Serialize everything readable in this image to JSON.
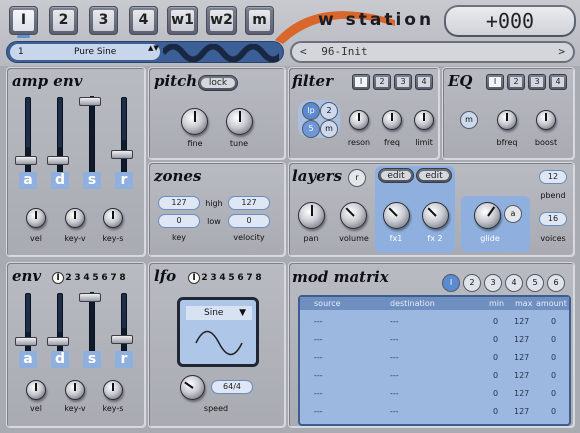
{
  "header": {
    "tabs": [
      {
        "label": "I",
        "selected": true
      },
      {
        "label": "2",
        "selected": false
      },
      {
        "label": "3",
        "selected": false
      },
      {
        "label": "4",
        "selected": false
      },
      {
        "label": "w1",
        "selected": false
      },
      {
        "label": "w2",
        "selected": false
      },
      {
        "label": "m",
        "selected": false
      }
    ],
    "logo": "w station",
    "display_value": "+000",
    "patch": {
      "number": "1",
      "name": "Pure Sine",
      "arrows": "▲▼"
    },
    "preset": {
      "prev": "<",
      "name": "96-Init",
      "next": ">"
    }
  },
  "amp_env": {
    "title": "amp env",
    "sliders": [
      {
        "letter": "a",
        "level": 0.45
      },
      {
        "letter": "d",
        "level": 0.45
      },
      {
        "letter": "s",
        "level": 1.0
      },
      {
        "letter": "r",
        "level": 0.52
      }
    ],
    "knobs": [
      "vel",
      "key-v",
      "key-s"
    ]
  },
  "pitch": {
    "title": "pitch",
    "lock_label": "lock",
    "knobs": [
      "fine",
      "tune"
    ]
  },
  "filter": {
    "title": "filter",
    "buttons": [
      "I",
      "2",
      "3",
      "4"
    ],
    "modes": [
      "lp",
      "2",
      "5",
      "m"
    ],
    "knobs": [
      "reson",
      "freq",
      "limit"
    ]
  },
  "eq": {
    "title": "EQ",
    "buttons": [
      "I",
      "2",
      "3",
      "4"
    ],
    "m_label": "m",
    "knobs": [
      "bfreq",
      "boost"
    ]
  },
  "zones": {
    "title": "zones",
    "key_high": "127",
    "key_low": "0",
    "vel_high": "127",
    "vel_low": "0",
    "high_label": "high",
    "low_label": "low",
    "key_label": "key",
    "velocity_label": "velocity"
  },
  "layers": {
    "title": "layers",
    "r_label": "r",
    "edit1": "edit",
    "edit2": "edit",
    "knobs": [
      "pan",
      "volume",
      "fx1",
      "fx 2"
    ],
    "glide_label": "glide",
    "a_label": "a",
    "pbend_value": "12",
    "pbend_label": "pbend",
    "voices_value": "16",
    "voices_label": "voices"
  },
  "env": {
    "title": "env",
    "numbers": [
      "I",
      "2",
      "3",
      "4",
      "5",
      "6",
      "7",
      "8"
    ],
    "sliders": [
      {
        "letter": "a",
        "level": 0.45
      },
      {
        "letter": "d",
        "level": 0.45
      },
      {
        "letter": "s",
        "level": 1.0
      },
      {
        "letter": "r",
        "level": 0.52
      }
    ],
    "knobs": [
      "vel",
      "key-v",
      "key-s"
    ]
  },
  "lfo": {
    "title": "lfo",
    "numbers": [
      "I",
      "2",
      "3",
      "4",
      "5",
      "6",
      "7",
      "8"
    ],
    "waveform": "Sine",
    "speed_value": "64/4",
    "speed_label": "speed"
  },
  "mod_matrix": {
    "title": "mod matrix",
    "pages": [
      "I",
      "2",
      "3",
      "4",
      "5",
      "6"
    ],
    "headers": {
      "source": "source",
      "destination": "destination",
      "min": "min",
      "max": "max",
      "amount": "amount"
    },
    "rows": [
      {
        "source": "---",
        "destination": "---",
        "min": "0",
        "max": "127",
        "amount": "0"
      },
      {
        "source": "---",
        "destination": "---",
        "min": "0",
        "max": "127",
        "amount": "0"
      },
      {
        "source": "---",
        "destination": "---",
        "min": "0",
        "max": "127",
        "amount": "0"
      },
      {
        "source": "---",
        "destination": "---",
        "min": "0",
        "max": "127",
        "amount": "0"
      },
      {
        "source": "---",
        "destination": "---",
        "min": "0",
        "max": "127",
        "amount": "0"
      },
      {
        "source": "---",
        "destination": "---",
        "min": "0",
        "max": "127",
        "amount": "0"
      }
    ]
  },
  "colors": {
    "accent": "#8fb0de",
    "panel": "#b4b6bd",
    "dark_blue": "#3b5f96",
    "orange": "#d9672b"
  }
}
